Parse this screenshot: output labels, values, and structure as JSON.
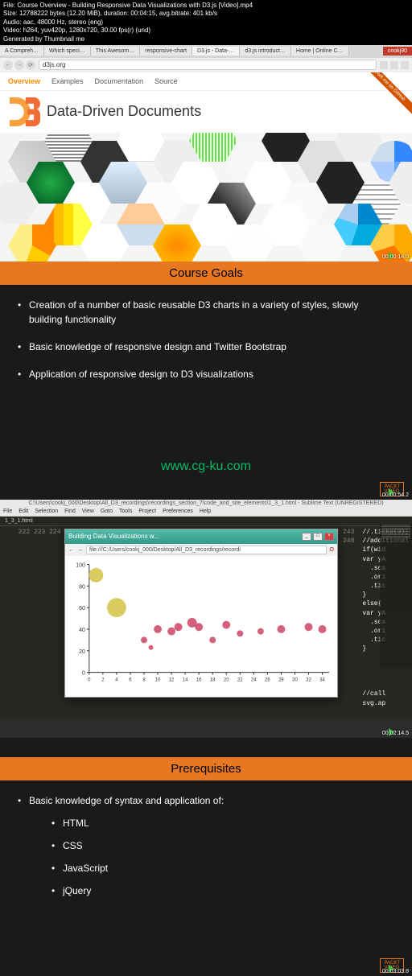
{
  "meta": {
    "line1": "File: Course Overview - Building Responsive Data Visualizations with D3.js [Video].mp4",
    "line2": "Size: 12788222 bytes (12.20 MiB), duration: 00:04:15, avg.bitrate: 401 kb/s",
    "line3": "Audio: aac, 48000 Hz, stereo (eng)",
    "line4": "Video: h264, yuv420p, 1280x720, 30.00 fps(r) (und)",
    "line5": "Generated by Thumbnail me"
  },
  "browser": {
    "tabs": [
      "A Compreh…",
      "Which speci…",
      "This Awesom…",
      "responsive-chart",
      "D3.js - Data-…",
      "d3.js introduct…",
      "Home | Online C…"
    ],
    "user": "cookj90",
    "url": "d3js.org",
    "nav_items": [
      "Overview",
      "Examples",
      "Documentation",
      "Source"
    ],
    "fork_label": "Fork me on GitHub",
    "d3_title": "Data-Driven Documents"
  },
  "timestamps": {
    "t1": "00:00:14.0",
    "t2": "00:00:54.2",
    "t3": "00:02:14.5",
    "t4": "00:03:03.8"
  },
  "slides": {
    "goals_title": "Course Goals",
    "goals": [
      "Creation of a number of basic reusable D3 charts in a variety of styles, slowly building functionality",
      "Basic knowledge of responsive design and Twitter Bootstrap",
      "Application of responsive design to D3 visualizations"
    ],
    "prereq_title": "Prerequisites",
    "prereq_intro": "Basic knowledge of syntax and application of:",
    "prereq_items": [
      "HTML",
      "CSS",
      "JavaScript",
      "jQuery"
    ],
    "watermark": "www.cg-ku.com",
    "packt_label": "PACKT",
    "packt_sub": "VIDEO"
  },
  "sublime": {
    "title": "C:\\Users\\cookj_000\\Desktop\\All_D3_recordings\\recordings_section_7\\code_and_site_elements\\1_3_1.html - Sublime Text (UNREGISTERED)",
    "menu": [
      "File",
      "Edit",
      "Selection",
      "Find",
      "View",
      "Goto",
      "Tools",
      "Project",
      "Preferences",
      "Help"
    ],
    "tab": "1_3_1.html",
    "lines_start": 222,
    "lines_end": 248,
    "window_title": "Building Data Visualizations w...",
    "chart_url": "file:///C:/Users/cookj_000/Desktop/All_D3_recordings/recordi",
    "code_lines": [
      "//.ticks(3);",
      "//additional",
      "if(wid",
      "var yA",
      "  .sca",
      "  .ori",
      "  .tic",
      "}",
      "else{",
      "var yA",
      "  .sca",
      "  .ori",
      "  .tic",
      "}",
      "",
      "",
      "",
      "",
      "//call",
      "svg.ap",
      ""
    ]
  },
  "chart_data": {
    "type": "scatter",
    "xlabel": "",
    "ylabel": "",
    "xlim": [
      0,
      35
    ],
    "ylim": [
      0,
      100
    ],
    "x_ticks": [
      0,
      2,
      4,
      6,
      8,
      10,
      12,
      14,
      16,
      18,
      20,
      22,
      24,
      26,
      28,
      30,
      32,
      34
    ],
    "y_ticks": [
      0,
      20,
      40,
      60,
      80,
      100
    ],
    "points": [
      {
        "x": 1,
        "y": 90,
        "r": 9,
        "color": "#d4c244"
      },
      {
        "x": 4,
        "y": 60,
        "r": 12,
        "color": "#d4c244"
      },
      {
        "x": 8,
        "y": 30,
        "r": 4,
        "color": "#c46"
      },
      {
        "x": 9,
        "y": 23,
        "r": 3,
        "color": "#c46"
      },
      {
        "x": 10,
        "y": 40,
        "r": 5,
        "color": "#c46"
      },
      {
        "x": 12,
        "y": 38,
        "r": 5,
        "color": "#c46"
      },
      {
        "x": 13,
        "y": 42,
        "r": 5,
        "color": "#c46"
      },
      {
        "x": 15,
        "y": 46,
        "r": 6,
        "color": "#c46"
      },
      {
        "x": 16,
        "y": 42,
        "r": 5,
        "color": "#c46"
      },
      {
        "x": 18,
        "y": 30,
        "r": 4,
        "color": "#c46"
      },
      {
        "x": 20,
        "y": 44,
        "r": 5,
        "color": "#c46"
      },
      {
        "x": 22,
        "y": 36,
        "r": 4,
        "color": "#c46"
      },
      {
        "x": 25,
        "y": 38,
        "r": 4,
        "color": "#c46"
      },
      {
        "x": 28,
        "y": 40,
        "r": 5,
        "color": "#c46"
      },
      {
        "x": 32,
        "y": 42,
        "r": 5,
        "color": "#c46"
      },
      {
        "x": 34,
        "y": 40,
        "r": 5,
        "color": "#c46"
      }
    ]
  }
}
